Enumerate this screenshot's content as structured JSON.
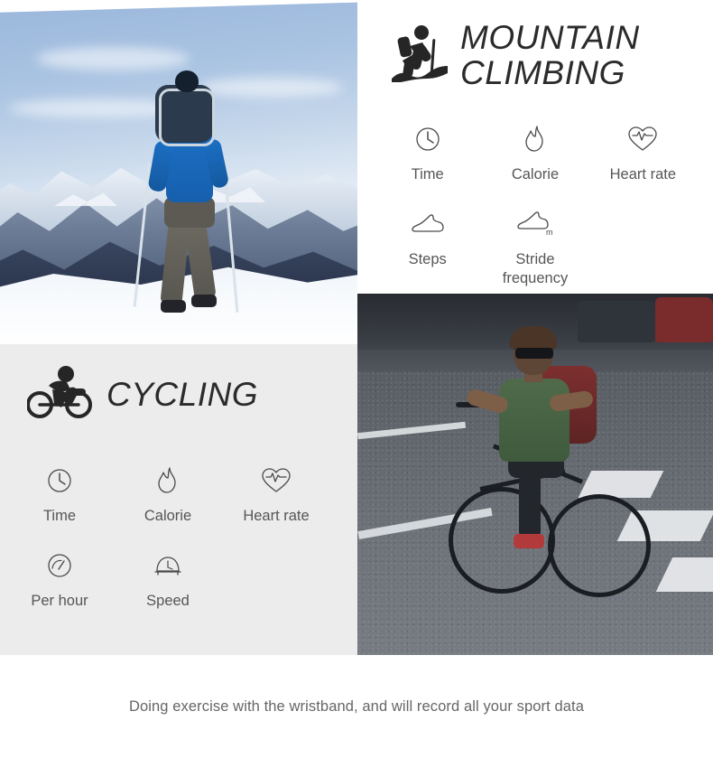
{
  "sections": [
    {
      "id": "mountain-climbing",
      "title": "MOUNTAIN CLIMBING",
      "hero_icon": "hiker-icon",
      "features": [
        {
          "label": "Time",
          "icon": "clock-icon"
        },
        {
          "label": "Calorie",
          "icon": "flame-icon"
        },
        {
          "label": "Heart rate",
          "icon": "heart-pulse-icon"
        },
        {
          "label": "Steps",
          "icon": "shoe-icon"
        },
        {
          "label": "Stride frequency",
          "icon": "shoe-meter-icon",
          "icon_badge": "m"
        }
      ]
    },
    {
      "id": "cycling",
      "title": "CYCLING",
      "hero_icon": "cyclist-icon",
      "features": [
        {
          "label": "Time",
          "icon": "clock-icon"
        },
        {
          "label": "Calorie",
          "icon": "flame-icon"
        },
        {
          "label": "Heart rate",
          "icon": "heart-pulse-icon"
        },
        {
          "label": "Per hour",
          "icon": "gauge-icon"
        },
        {
          "label": "Speed",
          "icon": "speedometer-icon"
        }
      ]
    }
  ],
  "caption": "Doing exercise with the wristband, and will record all your sport data",
  "photos": {
    "mountain": "hiker-with-backpack-on-snowy-mountain-photo",
    "cycling": "man-cycling-on-city-street-photo"
  },
  "colors": {
    "panel_gray": "#ececec",
    "title_dark": "#2b2b2b",
    "label_gray": "#565656",
    "caption_gray": "#666666",
    "background": "#ffffff"
  }
}
